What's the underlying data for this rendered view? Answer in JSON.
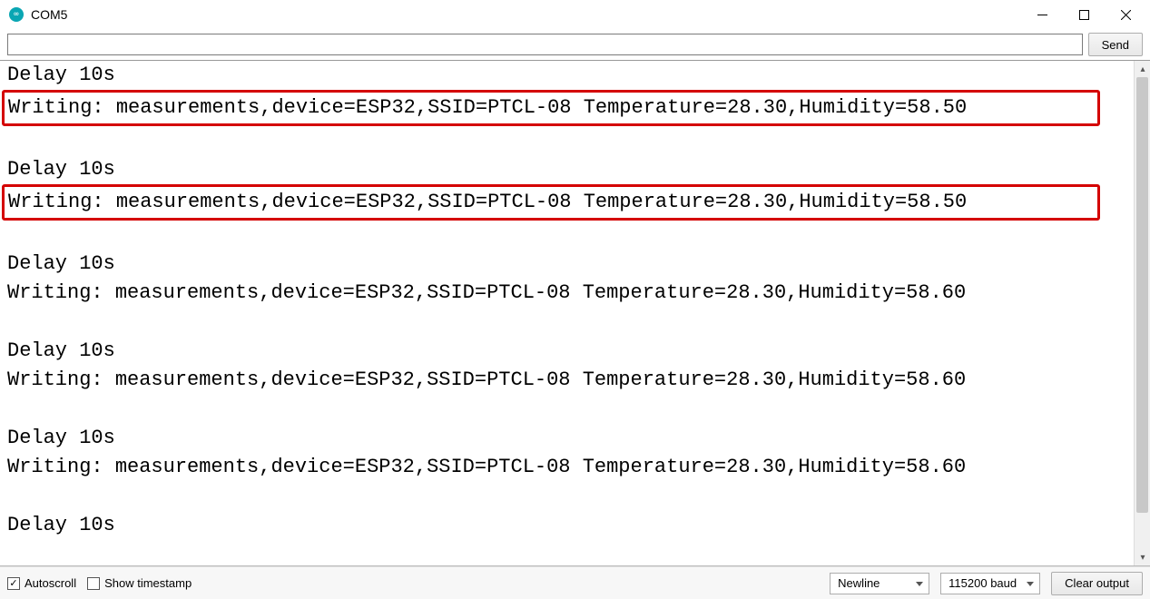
{
  "window": {
    "title": "COM5"
  },
  "toolbar": {
    "input_value": "",
    "send_label": "Send"
  },
  "output_lines": [
    {
      "text": "Delay 10s",
      "highlight": false,
      "blank": false
    },
    {
      "text": "Writing: measurements,device=ESP32,SSID=PTCL-08 Temperature=28.30,Humidity=58.50",
      "highlight": true,
      "blank": false
    },
    {
      "text": "",
      "highlight": false,
      "blank": true
    },
    {
      "text": "Delay 10s",
      "highlight": false,
      "blank": false
    },
    {
      "text": "Writing: measurements,device=ESP32,SSID=PTCL-08 Temperature=28.30,Humidity=58.50",
      "highlight": true,
      "blank": false
    },
    {
      "text": "",
      "highlight": false,
      "blank": true
    },
    {
      "text": "Delay 10s",
      "highlight": false,
      "blank": false
    },
    {
      "text": "Writing: measurements,device=ESP32,SSID=PTCL-08 Temperature=28.30,Humidity=58.60",
      "highlight": false,
      "blank": false
    },
    {
      "text": "",
      "highlight": false,
      "blank": true
    },
    {
      "text": "Delay 10s",
      "highlight": false,
      "blank": false
    },
    {
      "text": "Writing: measurements,device=ESP32,SSID=PTCL-08 Temperature=28.30,Humidity=58.60",
      "highlight": false,
      "blank": false
    },
    {
      "text": "",
      "highlight": false,
      "blank": true
    },
    {
      "text": "Delay 10s",
      "highlight": false,
      "blank": false
    },
    {
      "text": "Writing: measurements,device=ESP32,SSID=PTCL-08 Temperature=28.30,Humidity=58.60",
      "highlight": false,
      "blank": false
    },
    {
      "text": "",
      "highlight": false,
      "blank": true
    },
    {
      "text": "Delay 10s",
      "highlight": false,
      "blank": false
    }
  ],
  "status": {
    "autoscroll_label": "Autoscroll",
    "autoscroll_checked": true,
    "timestamp_label": "Show timestamp",
    "timestamp_checked": false,
    "line_ending": "Newline",
    "baud": "115200 baud",
    "clear_label": "Clear output"
  }
}
